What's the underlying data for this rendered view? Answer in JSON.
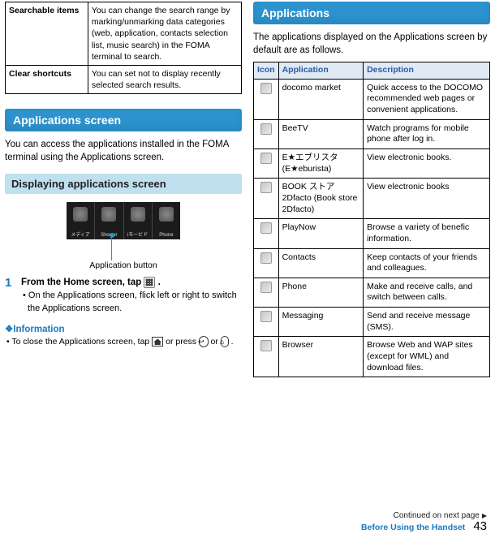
{
  "left": {
    "settings_table": [
      {
        "label": "Searchable items",
        "desc": "You can change the search range by marking/unmarking data categories (web, application, contacts selection list, music search) in the FOMA terminal to search."
      },
      {
        "label": "Clear shortcuts",
        "desc": "You can set not to display recently selected search results."
      }
    ],
    "h1": "Applications screen",
    "h1_para": "You can access the applications installed in the FOMA terminal using the Applications screen.",
    "h2": "Displaying applications screen",
    "illus_cells": [
      "メディア",
      "Shower",
      "iモービド",
      "Phone"
    ],
    "caption": "Application button",
    "step": {
      "num": "1",
      "title_before": "From the Home screen, tap ",
      "title_after": ".",
      "sub": "On the Applications screen, flick left or right to switch the Applications screen."
    },
    "info_h": "❖Information",
    "info_item_before": "To close the Applications screen, tap ",
    "info_item_mid": " or press ",
    "info_item_or": " or ",
    "info_item_after": " .",
    "back_glyph": "↩",
    "home_glyph": "⌂"
  },
  "right": {
    "h1": "Applications",
    "h1_para": "The applications displayed on the Applications screen by default are as follows.",
    "headers": {
      "icon": "Icon",
      "app": "Application",
      "desc": "Description"
    },
    "rows": [
      {
        "app": "docomo market",
        "desc": "Quick access to the DOCOMO recommended web pages or convenient applications."
      },
      {
        "app": "BeeTV",
        "desc": "Watch programs for mobile phone after log in."
      },
      {
        "app": "E★エブリスタ (E★eburista)",
        "desc": "View electronic books."
      },
      {
        "app": "BOOK ストア 2Dfacto (Book store 2Dfacto)",
        "desc": "View electronic books"
      },
      {
        "app": "PlayNow",
        "desc": "Browse a variety of benefic information."
      },
      {
        "app": "Contacts",
        "desc": "Keep contacts of your friends and colleagues."
      },
      {
        "app": "Phone",
        "desc": "Make and receive calls, and switch between calls."
      },
      {
        "app": "Messaging",
        "desc": "Send and receive message (SMS)."
      },
      {
        "app": "Browser",
        "desc": "Browse Web and WAP sites (except for WML) and download files."
      }
    ]
  },
  "footer": {
    "section": "Before Using the Handset",
    "page": "43",
    "cont": "Continued on next page"
  }
}
